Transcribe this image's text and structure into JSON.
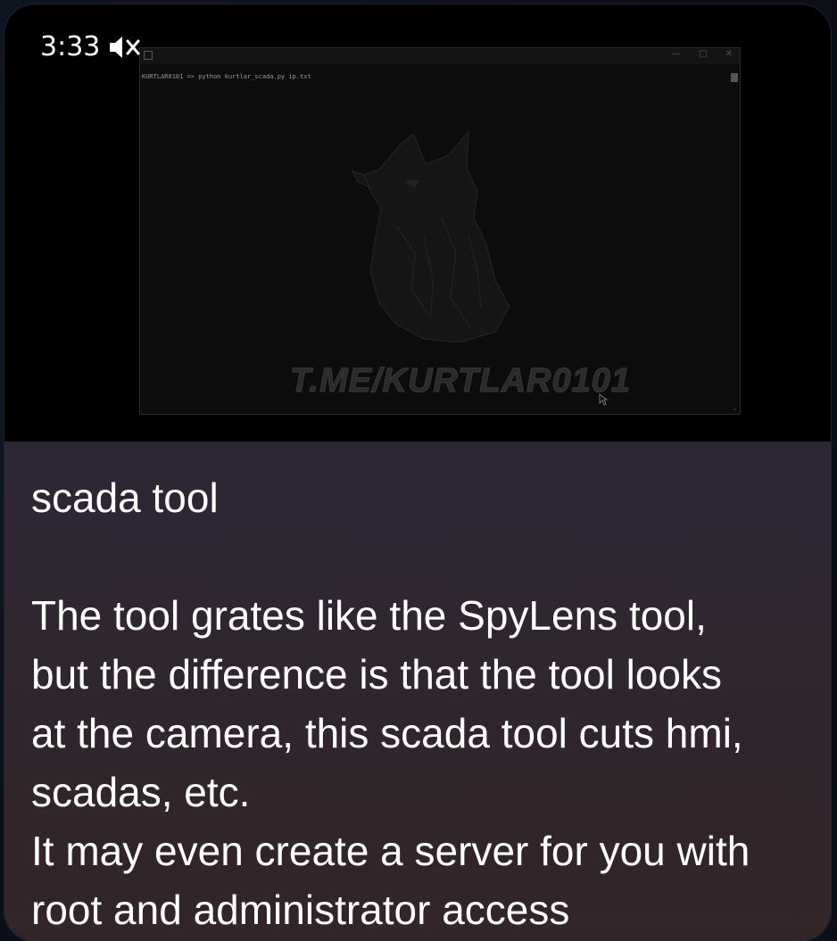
{
  "video": {
    "time": "3:33",
    "mute_icon": "speaker-muted-icon",
    "terminal": {
      "command_line": "KURTLAR0101 => python kurtlar_scada.py ip.txt",
      "controls": [
        "—",
        "□",
        "✕"
      ],
      "watermark": "T.ME/KURTLAR0101"
    }
  },
  "message": {
    "title": "scada tool",
    "body_lines": [
      "The tool grates like the SpyLens tool,",
      "but the difference is that the tool looks",
      "at the camera, this scada tool cuts hmi,",
      "scadas, etc.",
      "It may even create a server for you with",
      "root and administrator access"
    ]
  }
}
